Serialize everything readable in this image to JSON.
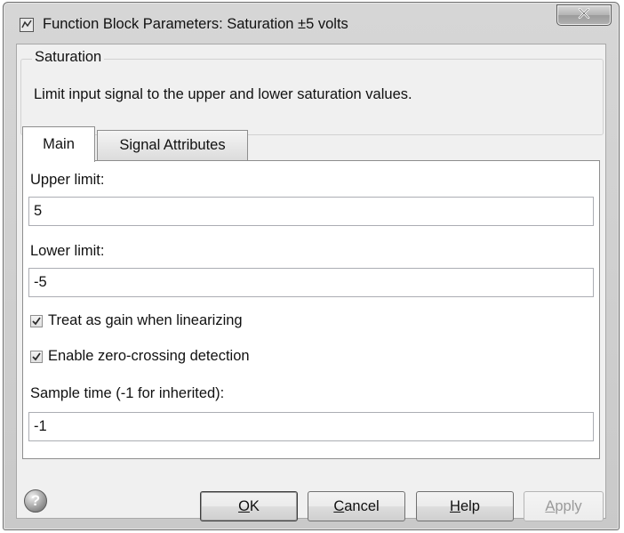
{
  "window": {
    "title": "Function Block Parameters: Saturation ±5 volts"
  },
  "block": {
    "name": "Saturation",
    "description": "Limit input signal to the upper and lower saturation values."
  },
  "tabs": [
    {
      "label": "Main",
      "active": true
    },
    {
      "label": "Signal Attributes",
      "active": false
    }
  ],
  "params": {
    "upper_limit": {
      "label": "Upper limit:",
      "value": "5"
    },
    "lower_limit": {
      "label": "Lower limit:",
      "value": "-5"
    },
    "treat_as_gain": {
      "label": "Treat as gain when linearizing",
      "checked": true
    },
    "zero_crossing": {
      "label": "Enable zero-crossing detection",
      "checked": true
    },
    "sample_time": {
      "label": "Sample time (-1 for inherited):",
      "value": "-1"
    }
  },
  "buttons": {
    "ok": {
      "mnemonic": "O",
      "rest": "K"
    },
    "cancel": {
      "mnemonic": "C",
      "rest": "ancel"
    },
    "help": {
      "mnemonic": "H",
      "rest": "elp"
    },
    "apply": {
      "mnemonic": "A",
      "rest": "pply",
      "enabled": false
    }
  }
}
